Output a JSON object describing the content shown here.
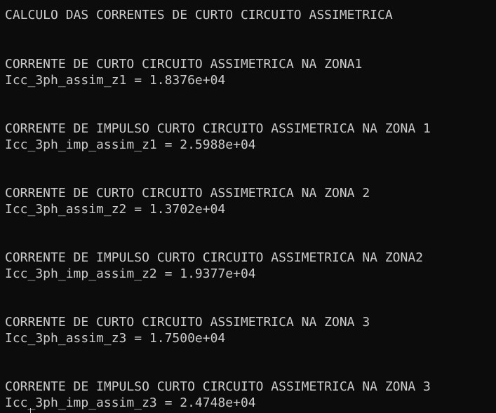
{
  "terminal": {
    "title_line": "CALCULO DAS CORRENTES DE CURTO CIRCUITO ASSIMETRICA",
    "blocks": [
      {
        "heading": "CORRENTE DE CURTO CIRCUITO ASSIMETRICA NA ZONA1",
        "result": "Icc_3ph_assim_z1 = 1.8376e+04"
      },
      {
        "heading": "CORRENTE DE IMPULSO CURTO CIRCUITO ASSIMETRICA NA ZONA 1",
        "result": "Icc_3ph_imp_assim_z1 = 2.5988e+04"
      },
      {
        "heading": "CORRENTE DE CURTO CIRCUITO ASSIMETRICA NA ZONA 2",
        "result": "Icc_3ph_assim_z2 = 1.3702e+04"
      },
      {
        "heading": "CORRENTE DE IMPULSO CURTO CIRCUITO ASSIMETRICA NA ZONA2",
        "result": "Icc_3ph_imp_assim_z2 = 1.9377e+04"
      },
      {
        "heading": "CORRENTE DE CURTO CIRCUITO ASSIMETRICA NA ZONA 3",
        "result": "Icc_3ph_assim_z3 = 1.7500e+04"
      },
      {
        "heading": "CORRENTE DE IMPULSO CURTO CIRCUITO ASSIMETRICA NA ZONA 3",
        "result": "Icc_3ph_imp_assim_z3 = 2.4748e+04"
      }
    ]
  },
  "colors": {
    "background": "#0c0c0c",
    "foreground": "#cccccc"
  }
}
